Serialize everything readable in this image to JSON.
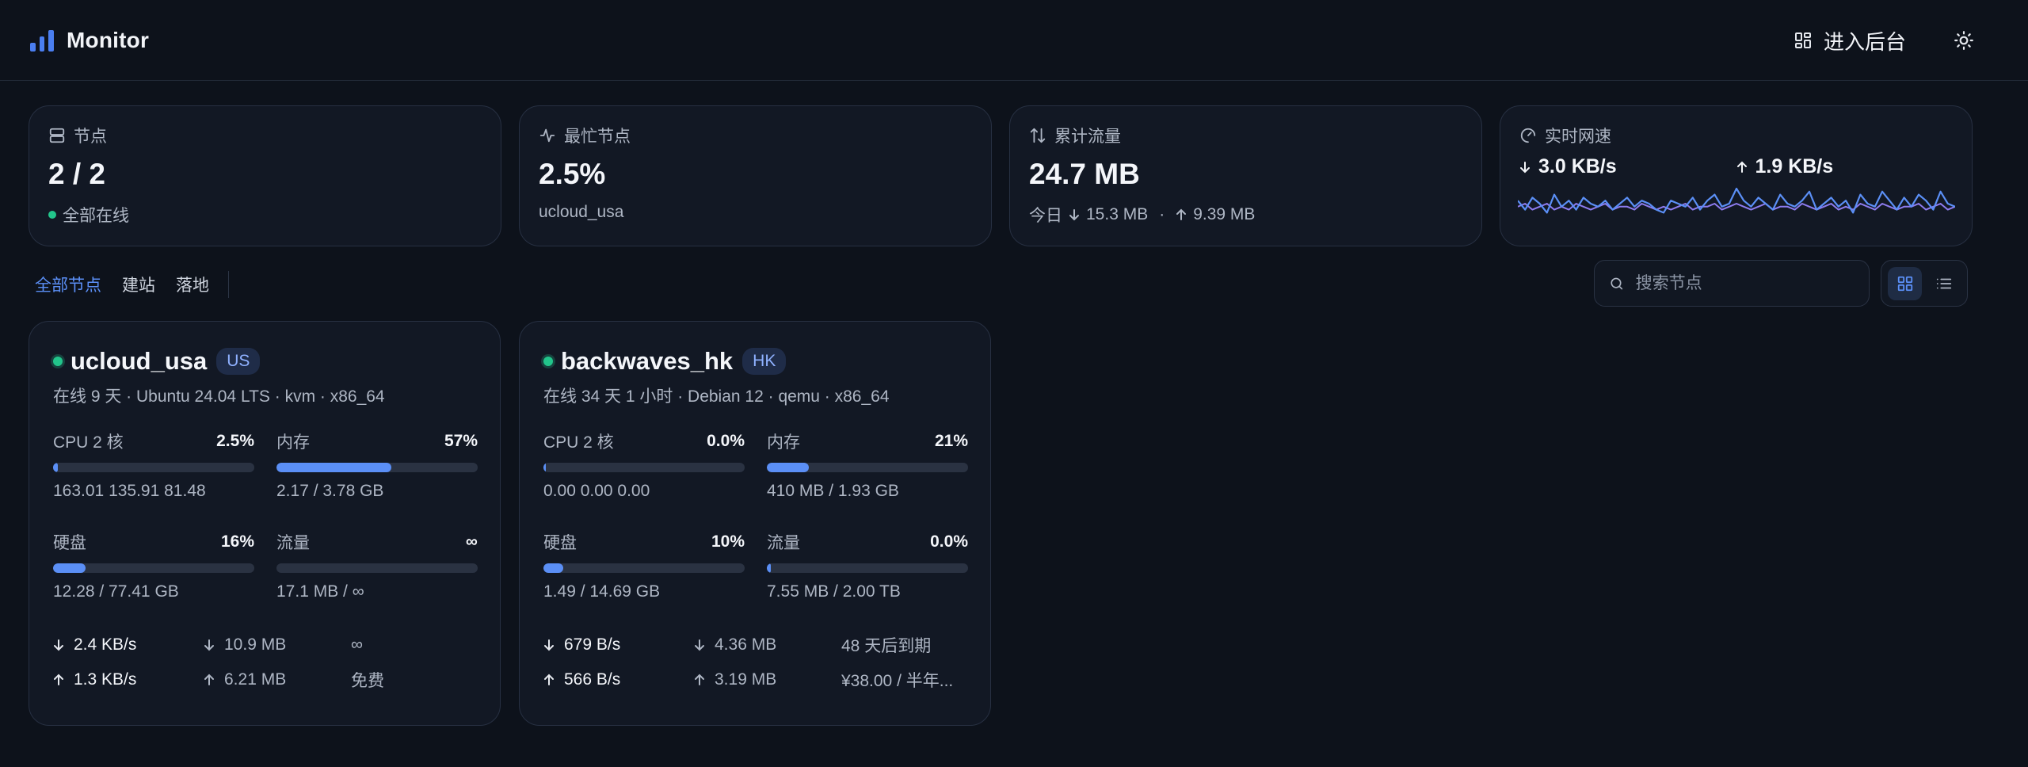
{
  "header": {
    "title": "Monitor",
    "admin_label": "进入后台"
  },
  "stats": {
    "nodes": {
      "label": "节点",
      "value": "2 / 2",
      "status": "全部在线"
    },
    "busiest": {
      "label": "最忙节点",
      "value": "2.5%",
      "node": "ucloud_usa"
    },
    "traffic": {
      "label": "累计流量",
      "value": "24.7 MB",
      "today_label": "今日",
      "today_down": "15.3 MB",
      "today_up": "9.39 MB",
      "separator": "·"
    },
    "speed": {
      "label": "实时网速",
      "down": "3.0 KB/s",
      "up": "1.9 KB/s"
    }
  },
  "filters": {
    "tabs": [
      "全部节点",
      "建站",
      "落地"
    ],
    "active": 0,
    "search_placeholder": "搜索节点"
  },
  "nodes": [
    {
      "name": "ucloud_usa",
      "region": "US",
      "info": "在线 9 天 · Ubuntu 24.04 LTS · kvm · x86_64",
      "cpu_label": "CPU 2 核",
      "cpu_val": "2.5%",
      "cpu_pct": 2.5,
      "cpu_sub": "163.01 135.91 81.48",
      "mem_label": "内存",
      "mem_val": "57%",
      "mem_pct": 57,
      "mem_sub": "2.17 / 3.78 GB",
      "disk_label": "硬盘",
      "disk_val": "16%",
      "disk_pct": 16,
      "disk_sub": "12.28 / 77.41 GB",
      "flow_label": "流量",
      "flow_val": "∞",
      "flow_pct": 0,
      "flow_sub": "17.1 MB / ∞",
      "down_speed": "2.4 KB/s",
      "up_speed": "1.3 KB/s",
      "down_total": "10.9 MB",
      "up_total": "6.21 MB",
      "expire": "∞",
      "price": "免费"
    },
    {
      "name": "backwaves_hk",
      "region": "HK",
      "info": "在线 34 天 1 小时 · Debian 12 · qemu · x86_64",
      "cpu_label": "CPU 2 核",
      "cpu_val": "0.0%",
      "cpu_pct": 1,
      "cpu_sub": "0.00 0.00 0.00",
      "mem_label": "内存",
      "mem_val": "21%",
      "mem_pct": 21,
      "mem_sub": "410 MB / 1.93 GB",
      "disk_label": "硬盘",
      "disk_val": "10%",
      "disk_pct": 10,
      "disk_sub": "1.49 / 14.69 GB",
      "flow_label": "流量",
      "flow_val": "0.0%",
      "flow_pct": 2,
      "flow_sub": "7.55 MB / 2.00 TB",
      "down_speed": "679 B/s",
      "up_speed": "566 B/s",
      "down_total": "4.36 MB",
      "up_total": "3.19 MB",
      "expire": "48 天后到期",
      "price": "¥38.00 / 半年..."
    }
  ],
  "colors": {
    "accent": "#5b8ff6",
    "online": "#22c58b",
    "background": "#0d121b",
    "card": "#121824"
  },
  "sparkline": {
    "down": [
      0.6,
      0.3,
      0.7,
      0.5,
      0.2,
      0.8,
      0.4,
      0.6,
      0.3,
      0.7,
      0.5,
      0.4,
      0.6,
      0.3,
      0.5,
      0.7,
      0.4,
      0.6,
      0.5,
      0.3,
      0.2,
      0.6,
      0.5,
      0.4,
      0.7,
      0.3,
      0.6,
      0.8,
      0.4,
      0.5,
      1.0,
      0.6,
      0.4,
      0.7,
      0.5,
      0.3,
      0.8,
      0.5,
      0.4,
      0.6,
      0.9,
      0.3,
      0.5,
      0.7,
      0.4,
      0.6,
      0.2,
      0.8,
      0.5,
      0.4,
      0.9,
      0.6,
      0.3,
      0.7,
      0.4,
      0.8,
      0.6,
      0.3,
      0.9,
      0.5,
      0.4
    ],
    "up": [
      0.4,
      0.5,
      0.3,
      0.4,
      0.5,
      0.3,
      0.4,
      0.3,
      0.5,
      0.4,
      0.3,
      0.4,
      0.5,
      0.3,
      0.4,
      0.4,
      0.3,
      0.5,
      0.4,
      0.3,
      0.4,
      0.3,
      0.4,
      0.5,
      0.3,
      0.4,
      0.4,
      0.5,
      0.3,
      0.4,
      0.5,
      0.4,
      0.3,
      0.4,
      0.5,
      0.3,
      0.4,
      0.4,
      0.3,
      0.5,
      0.4,
      0.3,
      0.4,
      0.5,
      0.3,
      0.4,
      0.3,
      0.5,
      0.4,
      0.3,
      0.5,
      0.4,
      0.3,
      0.4,
      0.4,
      0.5,
      0.3,
      0.4,
      0.5,
      0.3,
      0.4
    ]
  }
}
